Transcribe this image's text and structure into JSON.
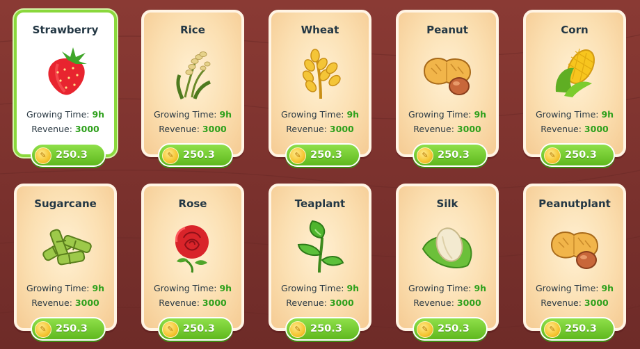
{
  "labels": {
    "growing_time": "Growing Time:",
    "revenue": "Revenue:"
  },
  "currency_icon": "coin-icon",
  "selected_index": 0,
  "crops": [
    {
      "name": "Strawberry",
      "icon": "strawberry-icon",
      "growing_time": "9h",
      "revenue": "3000",
      "price": "250.3"
    },
    {
      "name": "Rice",
      "icon": "rice-icon",
      "growing_time": "9h",
      "revenue": "3000",
      "price": "250.3"
    },
    {
      "name": "Wheat",
      "icon": "wheat-icon",
      "growing_time": "9h",
      "revenue": "3000",
      "price": "250.3"
    },
    {
      "name": "Peanut",
      "icon": "peanut-icon",
      "growing_time": "9h",
      "revenue": "3000",
      "price": "250.3"
    },
    {
      "name": "Corn",
      "icon": "corn-icon",
      "growing_time": "9h",
      "revenue": "3000",
      "price": "250.3"
    },
    {
      "name": "Sugarcane",
      "icon": "sugarcane-icon",
      "growing_time": "9h",
      "revenue": "3000",
      "price": "250.3"
    },
    {
      "name": "Rose",
      "icon": "rose-icon",
      "growing_time": "9h",
      "revenue": "3000",
      "price": "250.3"
    },
    {
      "name": "Teaplant",
      "icon": "teaplant-icon",
      "growing_time": "9h",
      "revenue": "3000",
      "price": "250.3"
    },
    {
      "name": "Silk",
      "icon": "silk-cocoon-icon",
      "growing_time": "9h",
      "revenue": "3000",
      "price": "250.3"
    },
    {
      "name": "Peanutplant",
      "icon": "peanutplant-icon",
      "growing_time": "9h",
      "revenue": "3000",
      "price": "250.3"
    }
  ],
  "colors": {
    "background": "#7a312d",
    "card": "#fbdfb1",
    "selected_border": "#8ad83c",
    "price_button": "#5fb81e",
    "value_text": "#2ea01c"
  }
}
